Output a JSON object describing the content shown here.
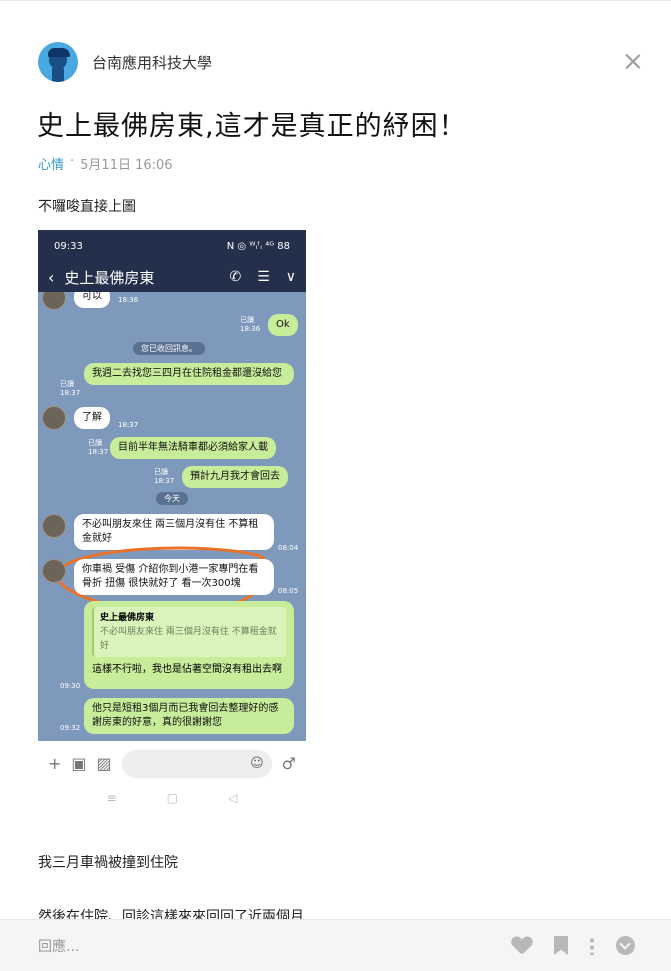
{
  "forum": {
    "name": "台南應用科技大學",
    "avatar_icon": "user-avatar-icon",
    "close_icon": "close-icon"
  },
  "post": {
    "title": "史上最佛房東,這才是真正的紓困！",
    "category": "心情",
    "separator": "·",
    "date": "5月11日 16:06",
    "intro": "不囉唆直接上圖",
    "para1": "我三月車禍被撞到住院",
    "para2": "然後在住院、回診這樣來來回回了近兩個月"
  },
  "screenshot": {
    "time": "09:33",
    "status_right": "N ◎ ᵂᵢᶠᵢ ⁴ᴳ 88",
    "back_icon": "chevron-left-icon",
    "chat_title": "史上最佛房東",
    "icons": [
      "phone-icon",
      "menu-icon",
      "chevron-down-icon"
    ],
    "messages": [
      {
        "side": "you",
        "text": "可以",
        "time": "18:36"
      },
      {
        "side": "me",
        "text": "Ok",
        "read": "已讀",
        "time": "18:36"
      },
      {
        "side": "sys",
        "text": "您已收回訊息。"
      },
      {
        "side": "me",
        "text": "我週二去找您三四月在住院租金都還沒給您",
        "read": "已讀",
        "time": "18:37"
      },
      {
        "side": "you",
        "text": "了解",
        "time": "18:37"
      },
      {
        "side": "me",
        "text": "目前半年無法騎車都必須給家人載",
        "read": "已讀",
        "time": "18:37"
      },
      {
        "side": "me",
        "text": "預計九月我才會回去",
        "read": "已讀",
        "time": "18:37"
      },
      {
        "side": "sys",
        "text": "今天"
      },
      {
        "side": "you",
        "text": "不必叫朋友來住 兩三個月沒有住 不算租金就好",
        "time": "08:04"
      },
      {
        "side": "you",
        "text": "你車禍 受傷 介紹你到小港一家專門在看骨折 扭傷 很快就好了 看一次300塊",
        "time": "08:05"
      },
      {
        "side": "me",
        "quote_name": "史上最佛房東",
        "quote_text": "不必叫朋友來住 兩三個月沒有住 不算租金就好",
        "text": "這樣不行啦，我也是佔著空間沒有租出去啊",
        "time": "09:30"
      },
      {
        "side": "me",
        "text": "他只是短租3個月而已我會回去整理好的感謝房東的好意，真的很謝謝您",
        "time": "09:32"
      }
    ],
    "input_icons": [
      "plus-icon",
      "camera-icon",
      "image-icon",
      "emoji-icon",
      "microphone-icon"
    ],
    "nav_icons": [
      "recent-apps-icon",
      "home-icon",
      "back-icon"
    ]
  },
  "reply": {
    "placeholder": "回應...",
    "icons": [
      "heart-icon",
      "bookmark-icon",
      "more-icon",
      "download-icon"
    ]
  },
  "colors": {
    "accent": "#3397cf",
    "line_bubble": "#c7ec9a",
    "chat_bg": "#7f99bd",
    "highlight": "#e8722a"
  }
}
